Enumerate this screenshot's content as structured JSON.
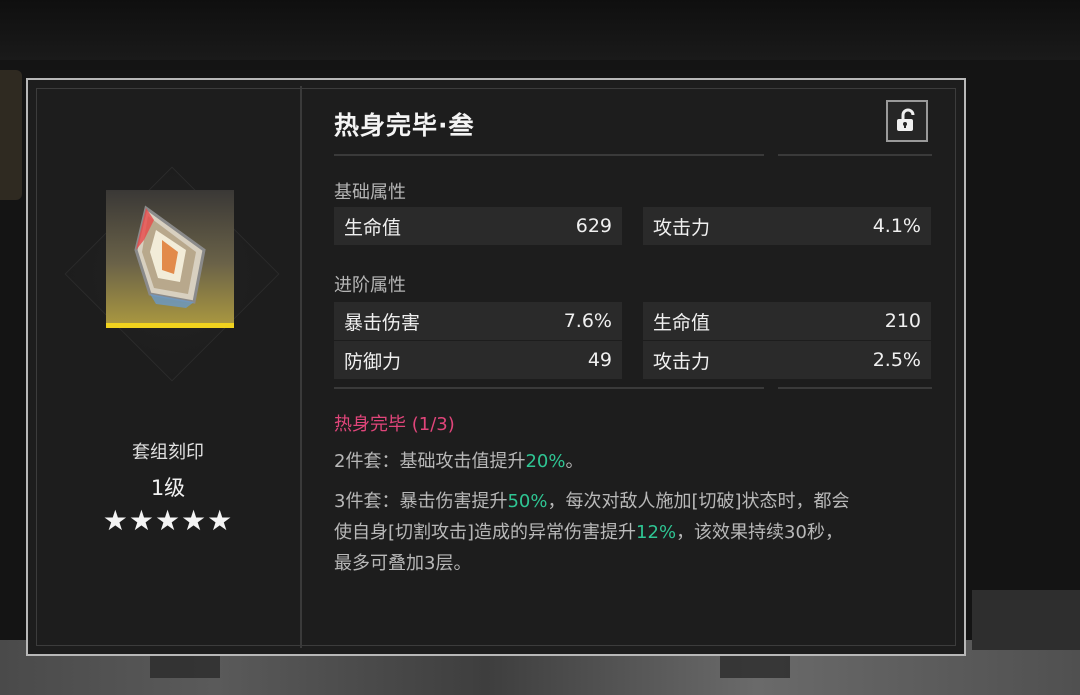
{
  "item": {
    "title": "热身完毕·叁",
    "set_label": "套组刻印",
    "level": "1级",
    "stars": "★★★★★",
    "rarity_color": "#f0d21e"
  },
  "lock": {
    "icon": "unlock-icon"
  },
  "base_stats": {
    "label": "基础属性",
    "rows": [
      [
        {
          "name": "生命值",
          "value": "629"
        },
        {
          "name": "攻击力",
          "value": "4.1%"
        }
      ]
    ]
  },
  "advanced_stats": {
    "label": "进阶属性",
    "rows": [
      [
        {
          "name": "暴击伤害",
          "value": "7.6%"
        },
        {
          "name": "生命值",
          "value": "210"
        }
      ],
      [
        {
          "name": "防御力",
          "value": "49"
        },
        {
          "name": "攻击力",
          "value": "2.5%"
        }
      ]
    ]
  },
  "set_bonus": {
    "title": "热身完毕 (1/3)",
    "title_color": "#e0457a",
    "highlight_color": "#2fc593",
    "two_piece": {
      "prefix": "2件套：基础攻击值提升",
      "hl": "20%",
      "suffix": "。"
    },
    "three_piece": {
      "line1_prefix": "3件套：暴击伤害提升",
      "line1_hl": "50%",
      "line1_suffix": "，每次对敌人施加[切破]状态时，都会",
      "line2_prefix": "使自身[切割攻击]造成的异常伤害提升",
      "line2_hl": "12%",
      "line2_suffix": "，该效果持续30秒，",
      "line3": "最多可叠加3层。"
    }
  }
}
